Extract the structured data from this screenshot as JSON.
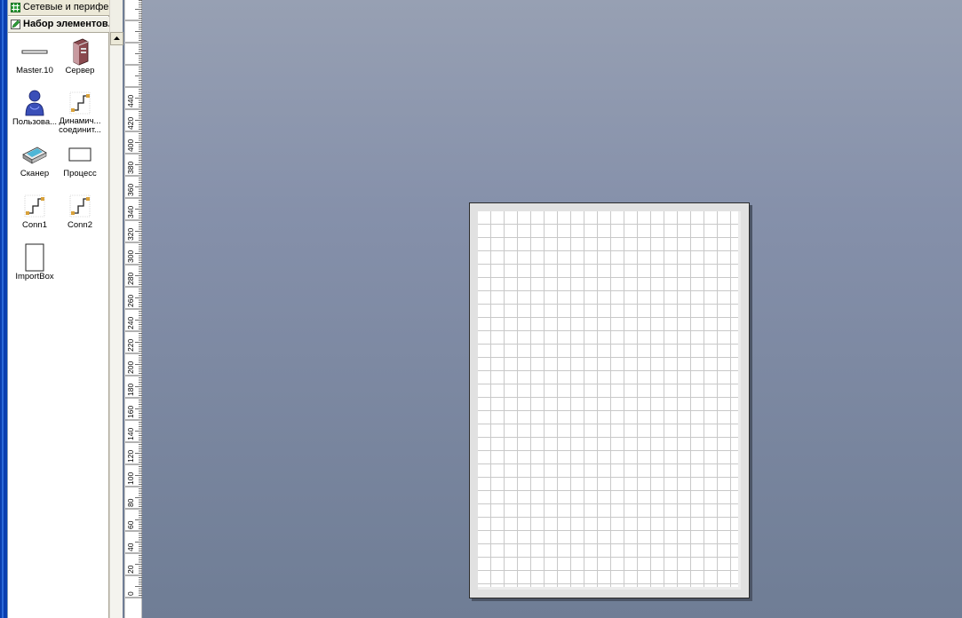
{
  "stencil": {
    "tabs": [
      {
        "title": "Сетевые и перифе...",
        "active": false
      },
      {
        "title": "Набор элементов...",
        "active": true
      }
    ],
    "shapes": [
      {
        "label": "Master.10",
        "icon": "line-shape-icon"
      },
      {
        "label": "Сервер",
        "icon": "server-icon"
      },
      {
        "label": "Пользова...",
        "icon": "user-icon"
      },
      {
        "label": "Динамич... соединит...",
        "icon": "dynamic-connector-icon"
      },
      {
        "label": "Сканер",
        "icon": "scanner-icon"
      },
      {
        "label": "Процесс",
        "icon": "process-icon"
      },
      {
        "label": "Conn1",
        "icon": "connector-icon"
      },
      {
        "label": "Conn2",
        "icon": "connector-icon"
      },
      {
        "label": "ImportBox",
        "icon": "import-box-icon"
      }
    ]
  },
  "ruler": {
    "ticks": [
      "440",
      "420",
      "400",
      "380",
      "360",
      "340",
      "320",
      "300",
      "280",
      "260",
      "240",
      "220",
      "200",
      "180",
      "160",
      "140",
      "120",
      "100",
      "80",
      "60",
      "40",
      "20",
      "0"
    ]
  },
  "colors": {
    "canvas_top": "#97a0b3",
    "canvas_bottom": "#6f7d95",
    "panel_header": "#ece9d8",
    "window_border": "#0a3fb0"
  }
}
